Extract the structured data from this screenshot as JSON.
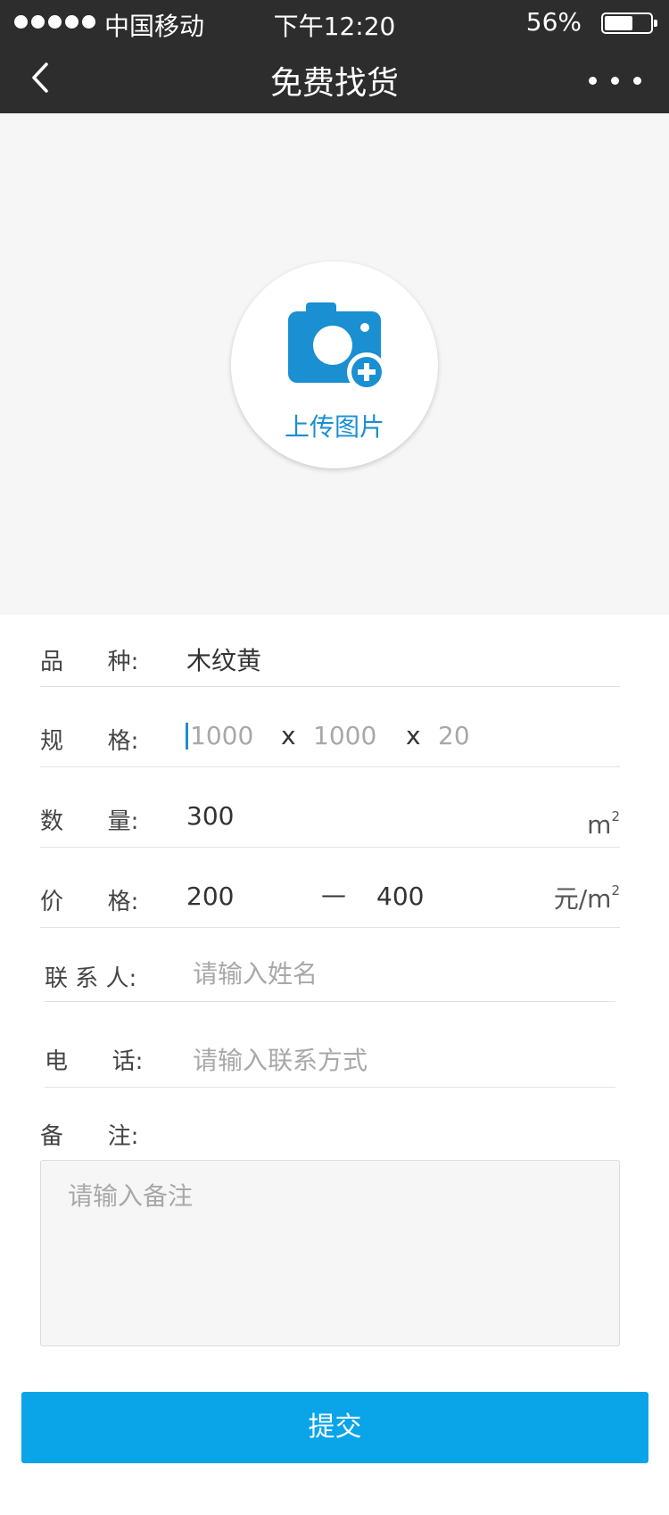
{
  "status_bar": {
    "carrier": "中国移动",
    "time": "下午12:20",
    "battery_percent": "56%",
    "battery_level": 0.56
  },
  "nav": {
    "title": "免费找货"
  },
  "upload": {
    "label": "上传图片",
    "icon": "camera-add-icon",
    "accent_color": "#1a8fd1"
  },
  "form": {
    "variety": {
      "label": "品      种:",
      "value": "木纹黄"
    },
    "spec": {
      "label": "规      格:",
      "length_placeholder": "1000",
      "sep1": "x",
      "width_placeholder": "1000",
      "sep2": "x",
      "thickness_placeholder": "20"
    },
    "quantity": {
      "label": "数      量:",
      "value": "300",
      "unit": "m",
      "unit_sup": "2"
    },
    "price": {
      "label": "价      格:",
      "min": "200",
      "dash": "—",
      "max": "400",
      "unit": "元/m",
      "unit_sup": "2"
    },
    "contact": {
      "label": "联 系 人:",
      "placeholder": "请输入姓名"
    },
    "phone": {
      "label": "电      话:",
      "placeholder": "请输入联系方式"
    },
    "remark": {
      "label": "备      注:",
      "placeholder": "请输入备注"
    }
  },
  "submit": {
    "label": "提交",
    "color": "#0aa5e9"
  }
}
